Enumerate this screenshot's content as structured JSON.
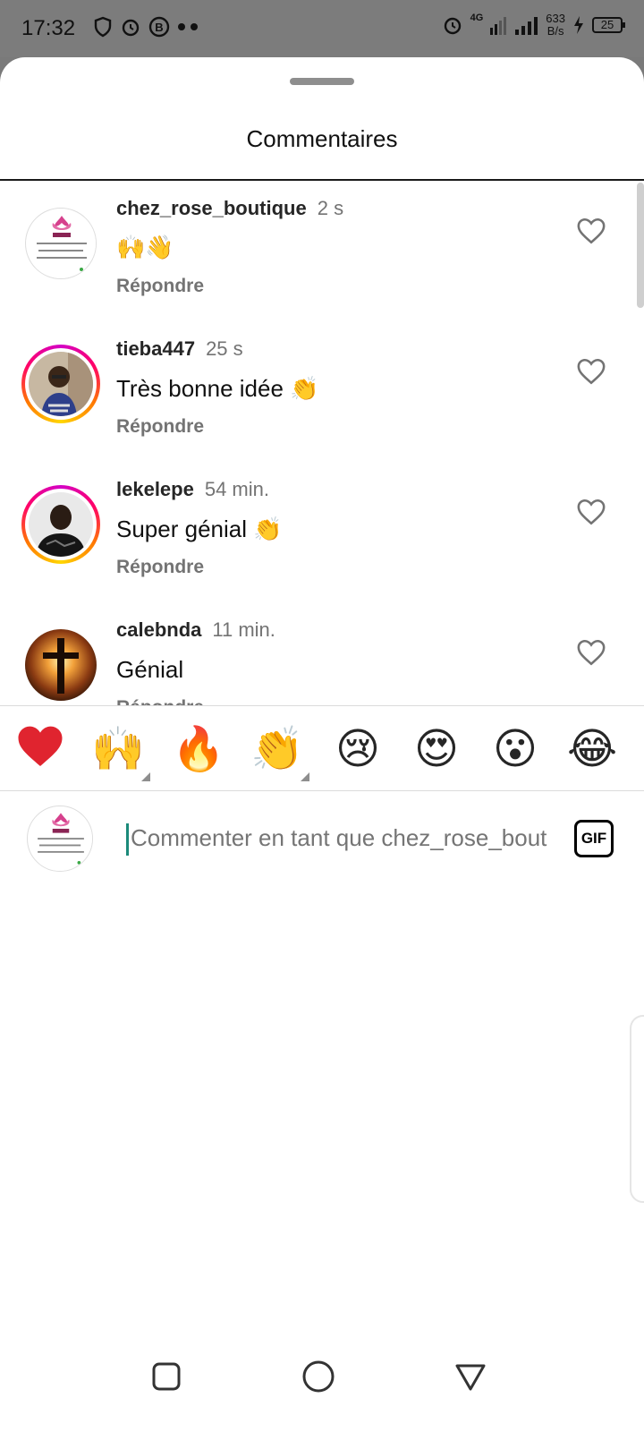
{
  "status_bar": {
    "time": "17:32",
    "network": "4G",
    "speed_value": "633",
    "speed_unit": "B/s",
    "battery": "25"
  },
  "sheet": {
    "title": "Commentaires"
  },
  "comments": [
    {
      "username": "chez_rose_boutique",
      "time": "2 s",
      "text": "🙌👋",
      "reply": "Répondre",
      "avatar": "rose-logo"
    },
    {
      "username": "tieba447",
      "time": "25 s",
      "text": "Très bonne idée 👏",
      "reply": "Répondre",
      "avatar": "person-photo"
    },
    {
      "username": "lekelepe",
      "time": "54 min.",
      "text": "Super génial 👏",
      "reply": "Répondre",
      "avatar": "person-photo"
    },
    {
      "username": "calebnda",
      "time": "11 min.",
      "text": "Génial",
      "reply": "Répondre",
      "avatar": "cross-sunset"
    }
  ],
  "reactions": [
    "❤️",
    "🙌",
    "🔥",
    "👏",
    "😢",
    "😍",
    "😮",
    "😂"
  ],
  "input": {
    "placeholder": "Commenter en tant que chez_rose_boutique",
    "gif_label": "GIF"
  },
  "colors": {
    "heart_red": "#e0242f",
    "ring_start": "#d300c5",
    "ring_end": "#ffd600",
    "caret": "#1b8a7a",
    "muted": "#737373"
  }
}
